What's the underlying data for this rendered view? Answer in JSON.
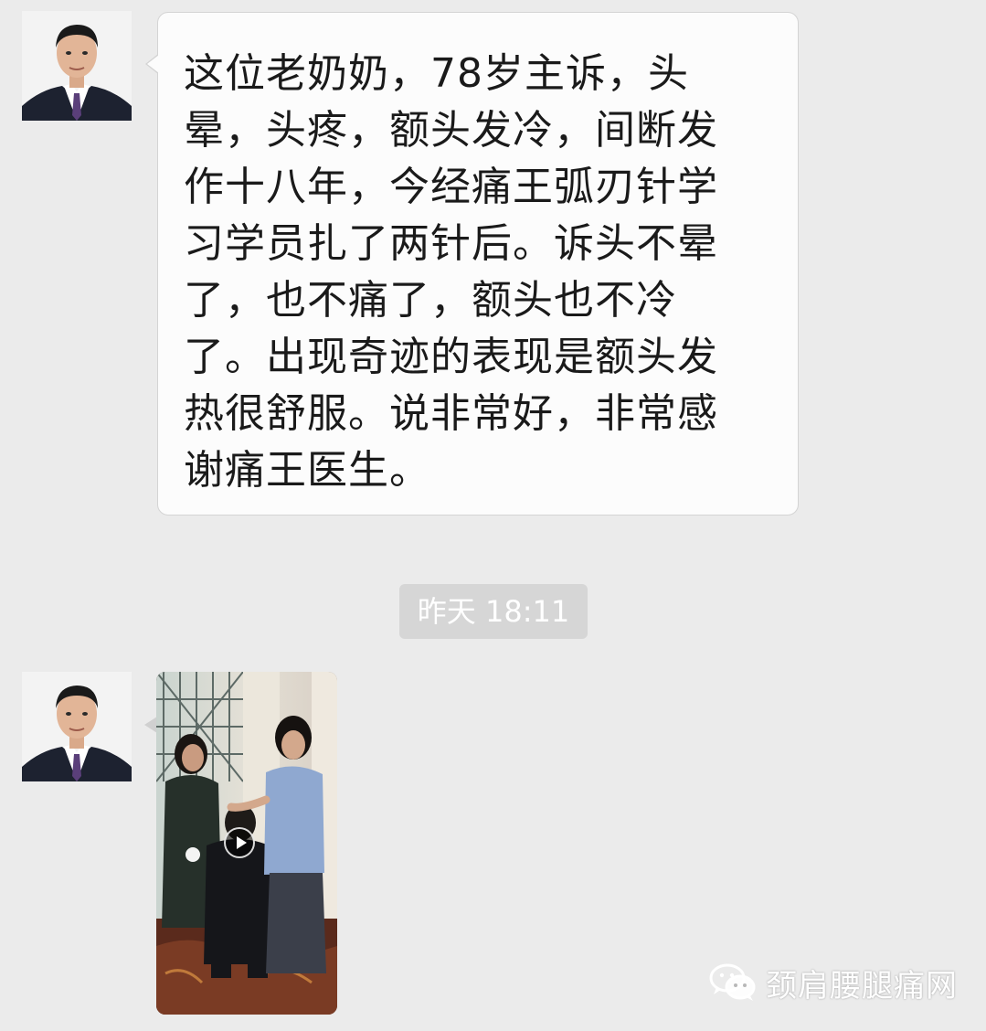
{
  "messages": [
    {
      "sender": "contact",
      "type": "text",
      "text": "这位老奶奶，78岁主诉，头\n晕，头疼，额头发冷，间断发\n作十八年，今经痛王弧刃针学\n习学员扎了两针后。诉头不晕\n了，也不痛了，额头也不冷\n了。出现奇迹的表现是额头发\n热很舒服。说非常好，非常感\n谢痛王医生。"
    },
    {
      "sender": "contact",
      "type": "video"
    }
  ],
  "timestamp": "昨天 18:11",
  "watermark": {
    "icon": "wechat-icon",
    "text": "颈肩腰腿痛网"
  },
  "colors": {
    "background": "#ebebeb",
    "bubble": "#fcfcfc",
    "timestamp_bg": "#d6d6d6"
  }
}
